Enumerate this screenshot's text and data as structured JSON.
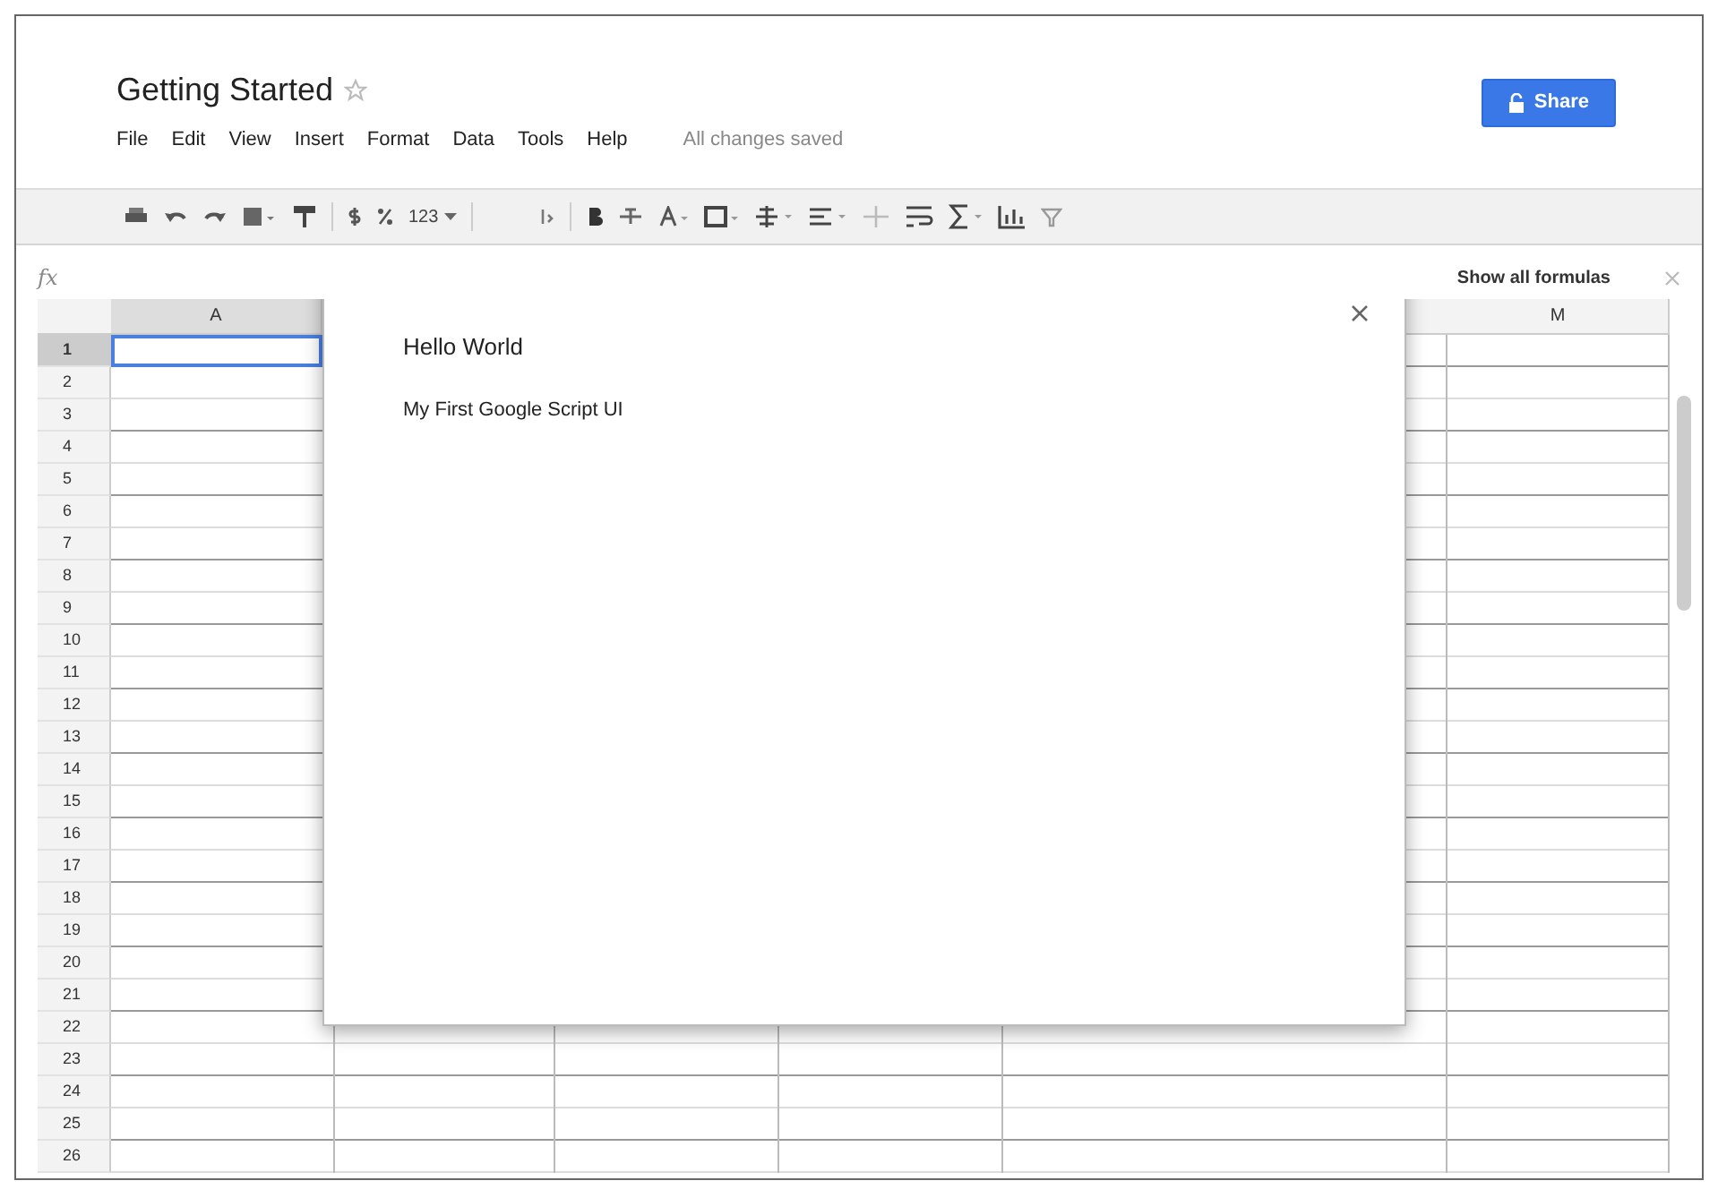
{
  "document": {
    "title": "Getting Started",
    "starred": false
  },
  "menu": [
    "File",
    "Edit",
    "View",
    "Insert",
    "Format",
    "Data",
    "Tools",
    "Help"
  ],
  "save_status": "All changes saved",
  "share_button": {
    "label": "Share"
  },
  "toolbar": {
    "number_format": "123"
  },
  "formula_bar": {
    "label": "fx"
  },
  "show_formulas": {
    "label": "Show all formulas"
  },
  "columns": [
    {
      "label": "A",
      "selected": true
    },
    {
      "label": "M",
      "selected": false
    }
  ],
  "rows": [
    {
      "label": "1",
      "selected": true
    },
    {
      "label": "2",
      "selected": false
    },
    {
      "label": "3",
      "selected": false
    },
    {
      "label": "4",
      "selected": false
    },
    {
      "label": "5",
      "selected": false
    },
    {
      "label": "6",
      "selected": false
    },
    {
      "label": "7",
      "selected": false
    },
    {
      "label": "8",
      "selected": false
    },
    {
      "label": "9",
      "selected": false
    },
    {
      "label": "10",
      "selected": false
    },
    {
      "label": "11",
      "selected": false
    },
    {
      "label": "12",
      "selected": false
    },
    {
      "label": "13",
      "selected": false
    },
    {
      "label": "14",
      "selected": false
    },
    {
      "label": "15",
      "selected": false
    },
    {
      "label": "16",
      "selected": false
    },
    {
      "label": "17",
      "selected": false
    },
    {
      "label": "18",
      "selected": false
    },
    {
      "label": "19",
      "selected": false
    },
    {
      "label": "20",
      "selected": false
    },
    {
      "label": "21",
      "selected": false
    },
    {
      "label": "22",
      "selected": false
    },
    {
      "label": "23",
      "selected": false
    },
    {
      "label": "24",
      "selected": false
    },
    {
      "label": "25",
      "selected": false
    },
    {
      "label": "26",
      "selected": false
    }
  ],
  "dialog": {
    "heading": "Hello World",
    "text": "My First Google Script UI"
  }
}
